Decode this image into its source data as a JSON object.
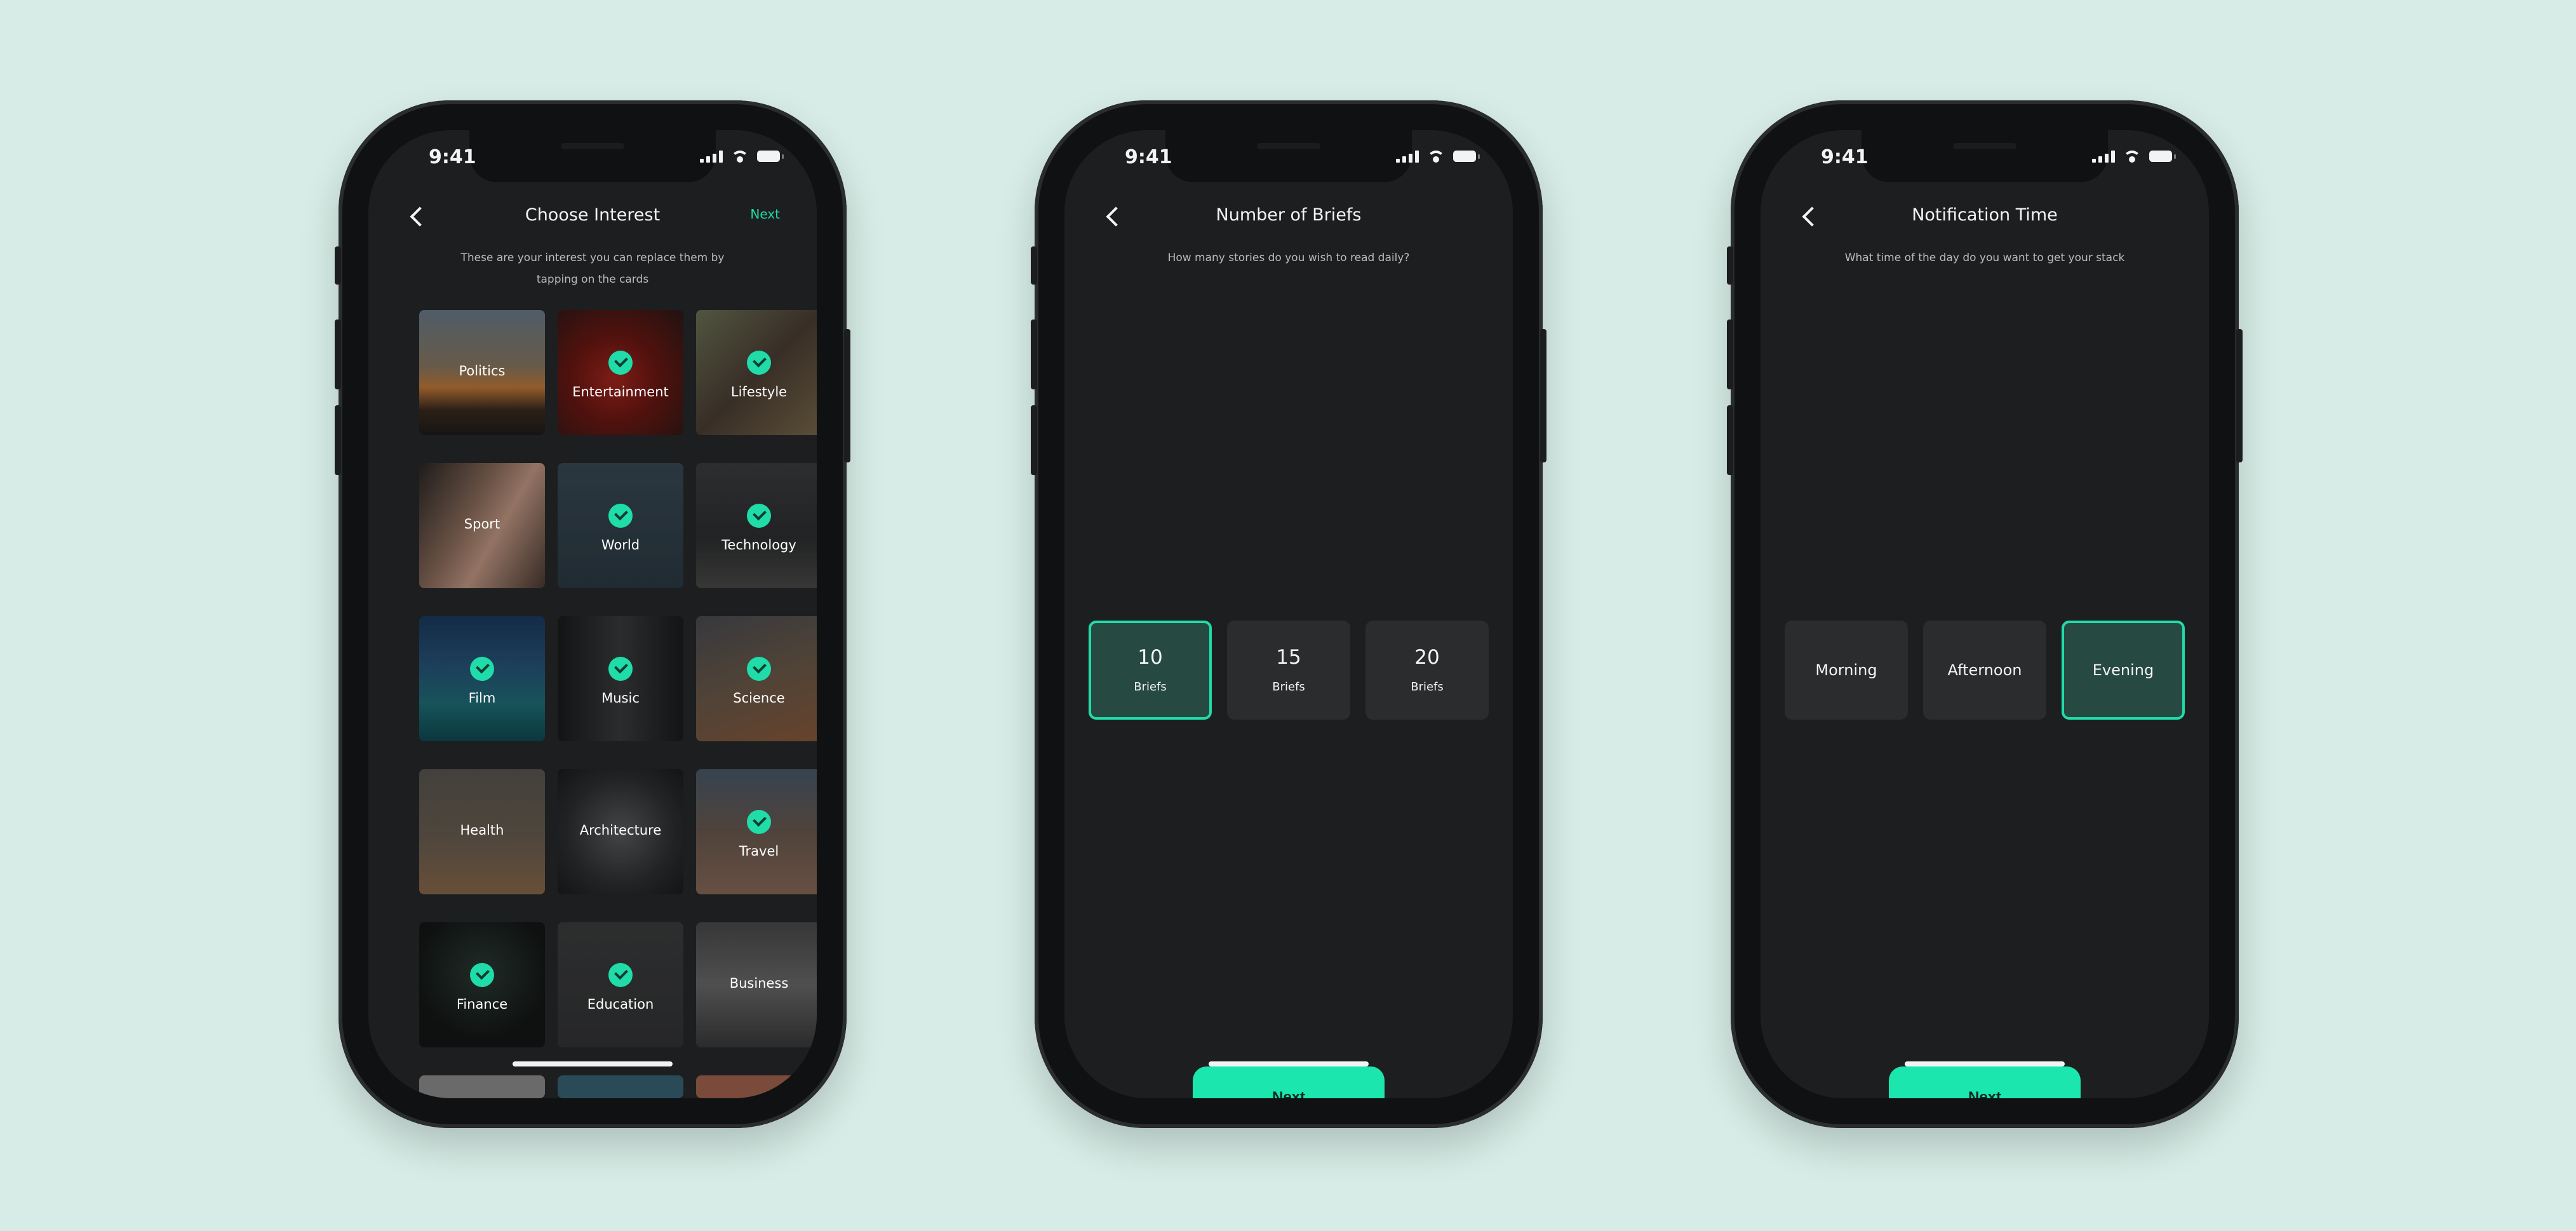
{
  "colors": {
    "background": "#d7ece6",
    "screen": "#1d1e20",
    "accent": "#1fdca8",
    "button": "#1be6ae",
    "selected_fill": "#264a41"
  },
  "status_bar": {
    "time": "9:41"
  },
  "screen1": {
    "title": "Choose Interest",
    "next_label": "Next",
    "subtitle": "These are your interest you can replace them by tapping on the cards",
    "cards": [
      {
        "label": "Politics",
        "checked": false
      },
      {
        "label": "Entertainment",
        "checked": true
      },
      {
        "label": "Lifestyle",
        "checked": true
      },
      {
        "label": "Sport",
        "checked": false
      },
      {
        "label": "World",
        "checked": true
      },
      {
        "label": "Technology",
        "checked": true
      },
      {
        "label": "Film",
        "checked": true
      },
      {
        "label": "Music",
        "checked": true
      },
      {
        "label": "Science",
        "checked": true
      },
      {
        "label": "Health",
        "checked": false
      },
      {
        "label": "Architecture",
        "checked": false
      },
      {
        "label": "Travel",
        "checked": true
      },
      {
        "label": "Finance",
        "checked": true
      },
      {
        "label": "Education",
        "checked": true
      },
      {
        "label": "Business",
        "checked": false
      }
    ]
  },
  "screen2": {
    "title": "Number of Briefs",
    "subtitle": "How many stories do you wish to read daily?",
    "options": [
      {
        "value": "10",
        "unit": "Briefs",
        "selected": true
      },
      {
        "value": "15",
        "unit": "Briefs",
        "selected": false
      },
      {
        "value": "20",
        "unit": "Briefs",
        "selected": false
      }
    ],
    "next_button": "Next"
  },
  "screen3": {
    "title": "Notification Time",
    "subtitle": "What time of the day do you want to get your stack",
    "options": [
      {
        "label": "Morning",
        "selected": false
      },
      {
        "label": "Afternoon",
        "selected": false
      },
      {
        "label": "Evening",
        "selected": true
      }
    ],
    "next_button": "Next"
  }
}
